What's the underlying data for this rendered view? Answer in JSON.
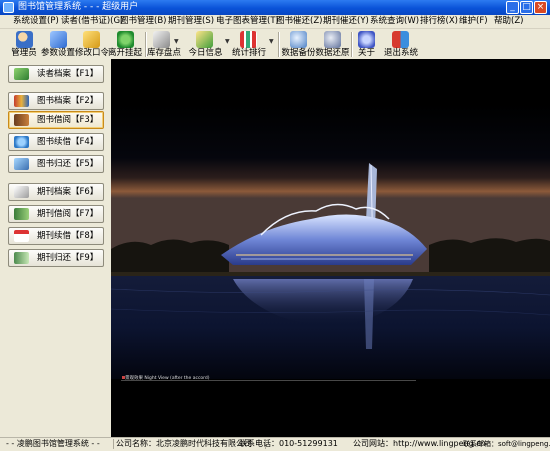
{
  "window": {
    "title": "图书馆管理系统 - - - 超级用户"
  },
  "menu": [
    "系统设置(P)",
    "读者(借书证)(G)",
    "图书管理(B)",
    "期刊管理(S)",
    "电子图表管理(T)",
    "图书催还(Z)",
    "期刊催还(Y)",
    "系统查询(W)",
    "排行榜(X)",
    "维护(F)",
    "帮助(Z)"
  ],
  "toolbar": {
    "items": [
      "管理员",
      "参数设置",
      "修改口令",
      "离开挂起",
      "库存盘点",
      "今日信息",
      "统计排行",
      "数据备份",
      "数据还原",
      "关于",
      "退出系统"
    ]
  },
  "sidebar": {
    "buttons": [
      "读者档案【F1】",
      "图书档案【F2】",
      "图书借阅【F3】",
      "图书续借【F4】",
      "图书归还【F5】",
      "期刊档案【F6】",
      "期刊借阅【F7】",
      "期刊续借【F8】",
      "期刊归还【F9】"
    ]
  },
  "main": {
    "caption": "景观效果 Night View (after the accord)"
  },
  "statusbar": {
    "app": "- - 凌鹏图书馆管理系统 - -",
    "company": "公司名称：北京凌鹏时代科技有限公司",
    "phone": "联系电话：010-51299131",
    "website": "公司网站：http://www.lingpeng.cn",
    "email": "联系邮箱：soft@lingpeng.cn"
  },
  "colors": {
    "titlebar": "#0a53d8",
    "face": "#ece9d8",
    "active_border": "#c98a1a"
  }
}
